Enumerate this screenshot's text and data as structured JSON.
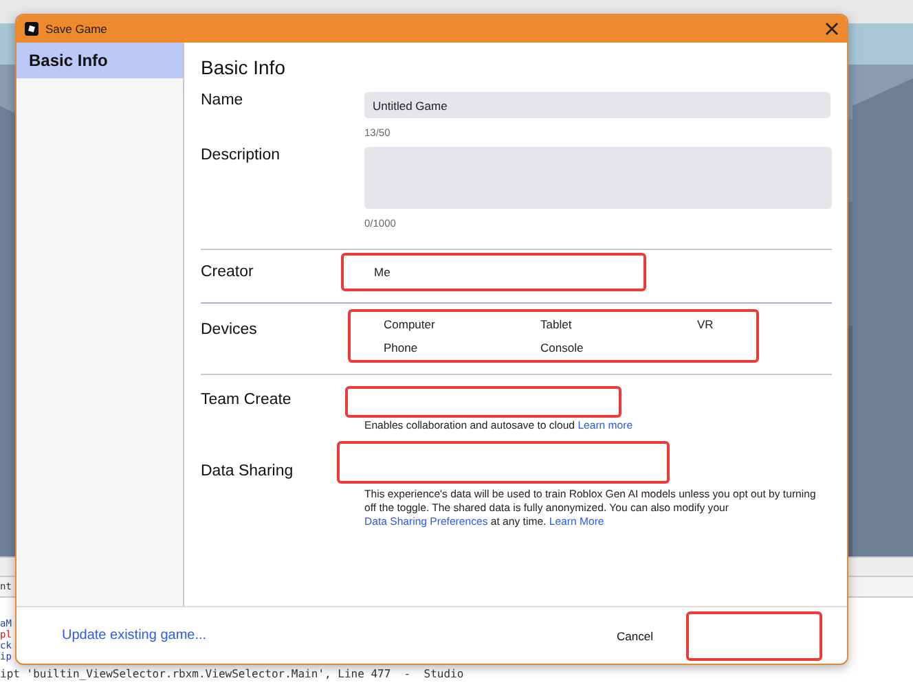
{
  "window": {
    "title": "Save Game"
  },
  "sidebar": {
    "items": [
      {
        "label": "Basic Info",
        "selected": true
      }
    ]
  },
  "section_title": "Basic Info",
  "fields": [
    {
      "kind": "text",
      "label": "Name",
      "value": "Untitled Game",
      "counter": "13/50"
    },
    {
      "kind": "textarea",
      "label": "Description",
      "counter": "0/1000"
    }
  ],
  "creator": {
    "label": "Creator",
    "value": "Me",
    "highlighted": true
  },
  "devices": {
    "label": "Devices",
    "highlighted": true,
    "options": [
      "Computer",
      "Tablet",
      "VR",
      "Phone",
      "Console"
    ]
  },
  "team_create": {
    "label": "Team Create",
    "highlighted": true,
    "note": "Enables collaboration and autosave to cloud",
    "link": "Learn more"
  },
  "data_sharing": {
    "label": "Data Sharing",
    "highlighted": true,
    "note": "This experience's data will be used to train Roblox Gen AI models unless you opt out by turning off the toggle. The shared data is fully anonymized. You can also modify your",
    "link": "Data Sharing Preferences",
    "note_end": "at any time.",
    "link_2": "Learn More"
  },
  "footer": {
    "link": "Update existing game...",
    "cancel": "Cancel",
    "primary_highlighted": true
  },
  "background": {
    "tab": "nt",
    "output": [
      {
        "kind": "info",
        "text": "aM"
      },
      {
        "kind": "error",
        "text": "pl"
      },
      {
        "kind": "info",
        "text": "ck"
      },
      {
        "kind": "info",
        "text": "ip"
      }
    ],
    "last_line": "ipt 'builtin_ViewSelector.rbxm.ViewSelector.Main', Line 477  -  Studio"
  }
}
